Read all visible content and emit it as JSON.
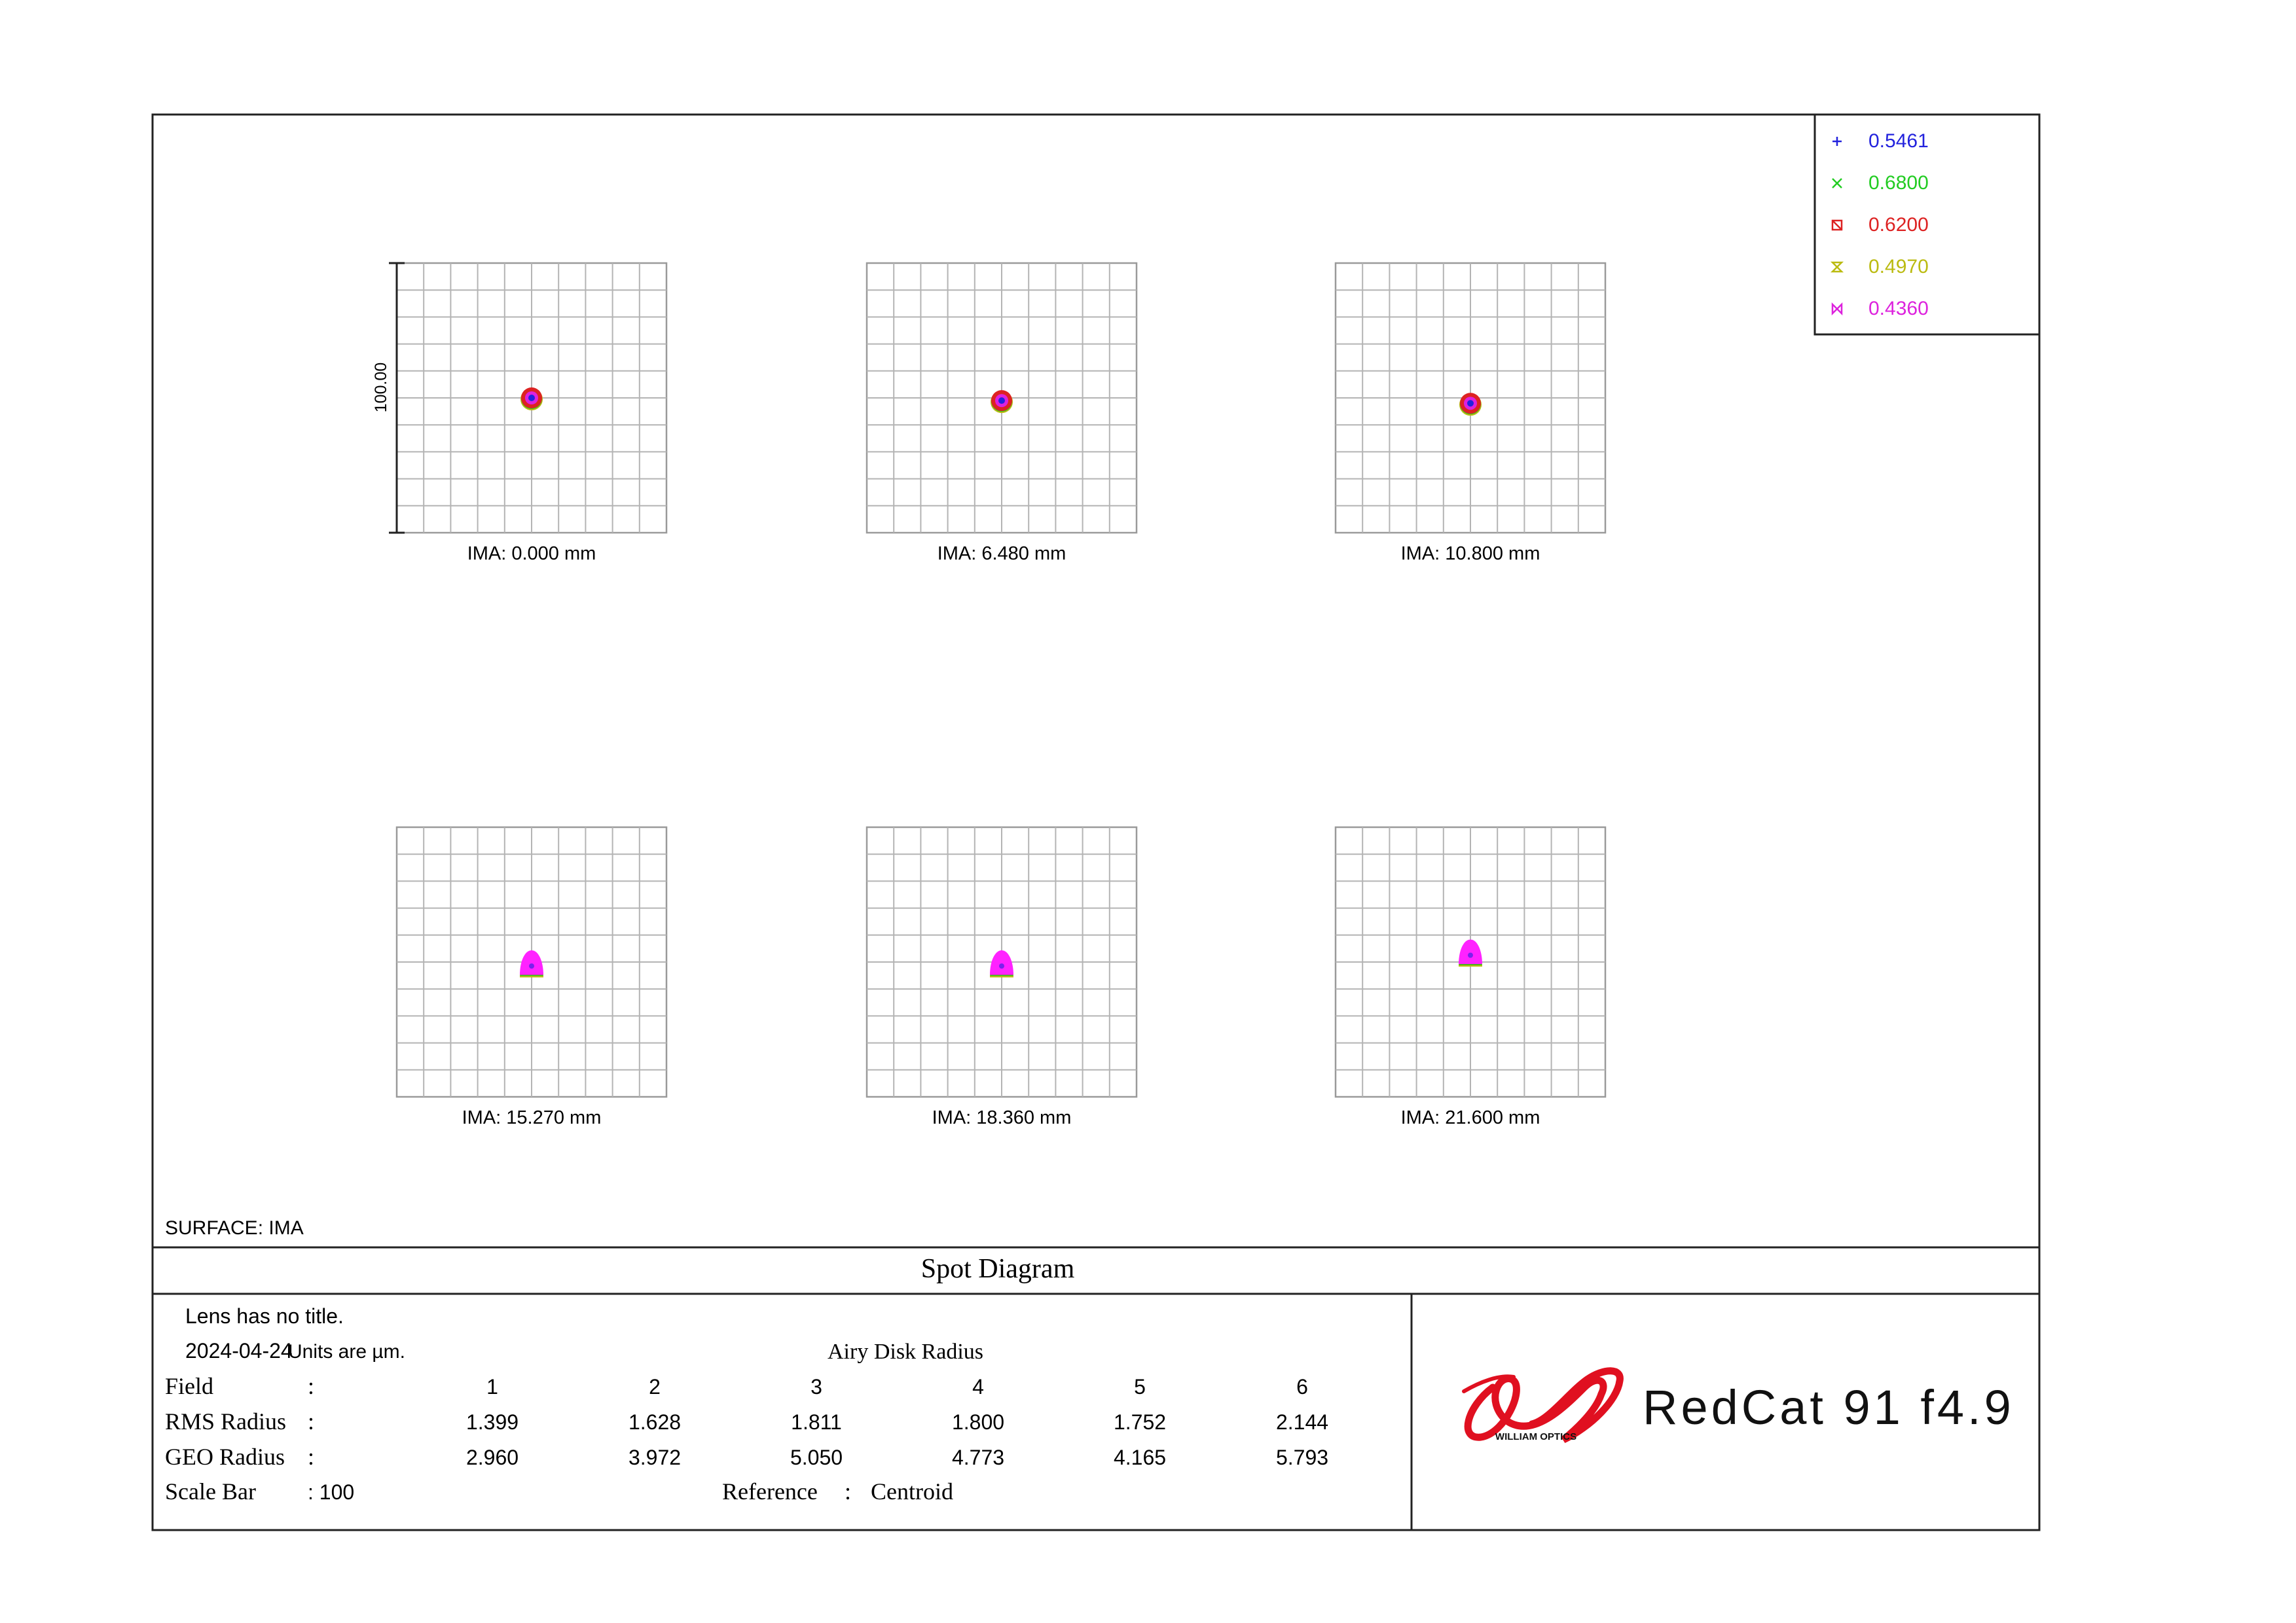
{
  "chart_data": {
    "type": "scatter",
    "title": "Spot Diagram",
    "surface_label": "SURFACE: IMA",
    "scale_bar_label": "100.00",
    "grid": true,
    "legend_placement": "top-right",
    "wavelengths": [
      {
        "label": "0.5461",
        "color": "#2222dd",
        "marker": "+"
      },
      {
        "label": "0.6800",
        "color": "#22cc22",
        "marker": "x"
      },
      {
        "label": "0.6200",
        "color": "#dd2222",
        "marker": "square-x"
      },
      {
        "label": "0.4970",
        "color": "#bbbb11",
        "marker": "hourglass"
      },
      {
        "label": "0.4360",
        "color": "#dd22dd",
        "marker": "bowtie"
      }
    ],
    "fields": [
      {
        "label": "IMA:  0.000 mm",
        "spot_offset_um": [
          0,
          0
        ],
        "spot_shape": "round"
      },
      {
        "label": "IMA:  6.480 mm",
        "spot_offset_um": [
          0,
          -1
        ],
        "spot_shape": "round"
      },
      {
        "label": "IMA:  10.800 mm",
        "spot_offset_um": [
          0,
          -2
        ],
        "spot_shape": "round"
      },
      {
        "label": "IMA:  15.270 mm",
        "spot_offset_um": [
          0,
          -1
        ],
        "spot_shape": "bell"
      },
      {
        "label": "IMA:  18.360 mm",
        "spot_offset_um": [
          0,
          -1
        ],
        "spot_shape": "bell"
      },
      {
        "label": "IMA:  21.600 mm",
        "spot_offset_um": [
          0,
          3
        ],
        "spot_shape": "bell"
      }
    ]
  },
  "info": {
    "lens_title": "Lens has no title.",
    "date": "2024-04-24",
    "units": "Units are µm.",
    "airy_label": "Airy Disk Radius",
    "field_label": "Field",
    "rms_label": "RMS Radius",
    "geo_label": "GEO Radius",
    "scale_label": "Scale Bar",
    "colon": ":",
    "scale_value": ": 100",
    "reference_label": "Reference",
    "reference_value": "Centroid",
    "field_numbers": [
      "1",
      "2",
      "3",
      "4",
      "5",
      "6"
    ],
    "rms_values": [
      "1.399",
      "1.628",
      "1.811",
      "1.800",
      "1.752",
      "2.144"
    ],
    "geo_values": [
      "2.960",
      "3.972",
      "5.050",
      "4.773",
      "4.165",
      "5.793"
    ]
  },
  "brand": {
    "logo_text": "WILLIAM OPTICS",
    "product": "RedCat 91  f4.9",
    "logo_color": "#e01020"
  }
}
